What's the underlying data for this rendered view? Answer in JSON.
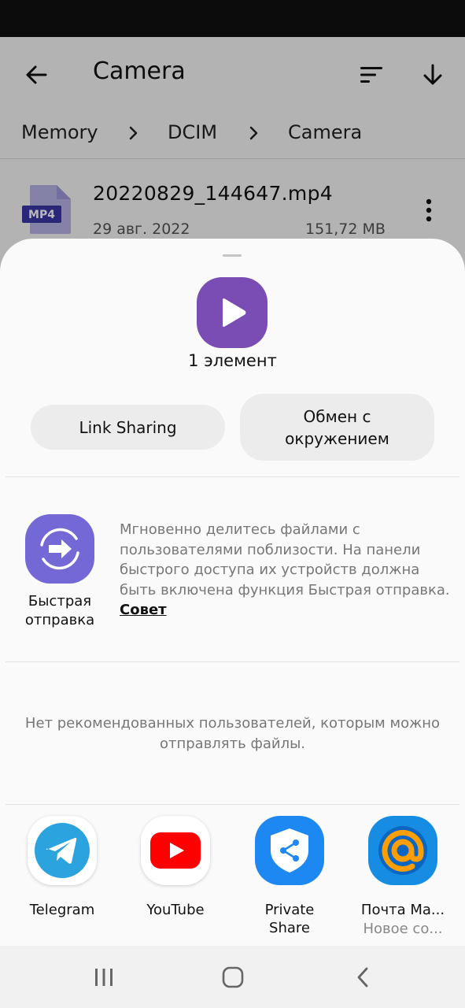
{
  "app": {
    "title": "Camera",
    "breadcrumb": [
      "Memory",
      "DCIM",
      "Camera"
    ],
    "file": {
      "type_label": "MP4",
      "name": "20220829_144647.mp4",
      "date": "29 авг. 2022",
      "size": "151,72 MB"
    }
  },
  "sheet": {
    "item_count": "1 элемент",
    "link_sharing": "Link Sharing",
    "nearby_share": "Обмен с окружением",
    "quick_share": {
      "label": "Быстрая отправка",
      "description": "Мгновенно делитесь файлами с пользователями поблизости. На панели быстрого доступа их устройств должна быть включена функция Быстрая отправка.",
      "tip": "Совет"
    },
    "no_recommendations": "Нет рекомендованных пользователей, которым можно отправлять файлы.",
    "apps": [
      {
        "name": "Telegram",
        "icon": "telegram-icon"
      },
      {
        "name": "YouTube",
        "icon": "youtube-icon"
      },
      {
        "name": "Private Share",
        "icon": "private-share-icon"
      },
      {
        "name": "Почта Ma...",
        "sub": "Новое со...",
        "icon": "mail-ru-icon"
      }
    ]
  },
  "colors": {
    "preview_purple": "#7a4db5",
    "quick_share_purple": "#7467d6",
    "telegram_blue": "#2aa3df",
    "youtube_red": "#ff0000",
    "private_share_blue": "#1d88f1",
    "mail_blue": "#168de2",
    "mail_orange": "#ff9e00"
  }
}
